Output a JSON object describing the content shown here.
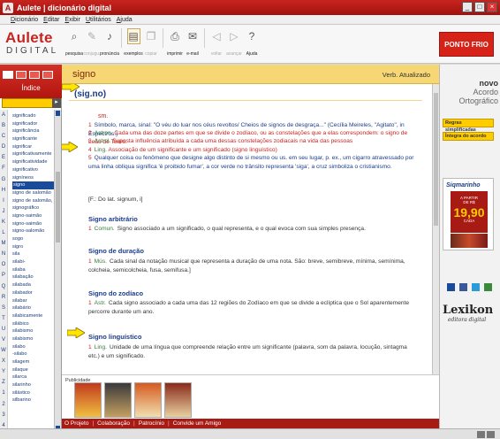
{
  "window": {
    "title": "Aulete | dicionário digital",
    "app_icon": "A"
  },
  "menu": [
    "Dicionário",
    "Editar",
    "Exibir",
    "Utilitários",
    "Ajuda"
  ],
  "logo": {
    "line1": "Aulete",
    "line2": "DIGITAL"
  },
  "toolbar": [
    {
      "label": "pesquisa",
      "icon": "magnifier-icon",
      "glyph": "⌕",
      "state": "on"
    },
    {
      "label": "conjugu.",
      "icon": "conjugation-icon",
      "glyph": "✎",
      "state": "off"
    },
    {
      "label": "pronúncia",
      "icon": "speaker-icon",
      "glyph": "♪",
      "state": "on"
    },
    {
      "label": "exemplos",
      "icon": "examples-icon",
      "glyph": "▤",
      "state": "boxed"
    },
    {
      "label": "copiar",
      "icon": "copy-icon",
      "glyph": "❐",
      "state": "off"
    },
    {
      "label": "imprimir",
      "icon": "print-icon",
      "glyph": "⎙",
      "state": "on"
    },
    {
      "label": "e-mail",
      "icon": "email-icon",
      "glyph": "✉",
      "state": "on"
    },
    {
      "label": "voltar",
      "icon": "back-icon",
      "glyph": "◁",
      "state": "off"
    },
    {
      "label": "avançar",
      "icon": "forward-icon",
      "glyph": "▷",
      "state": "off"
    },
    {
      "label": "Ajuda",
      "icon": "help-icon",
      "glyph": "?",
      "state": "on"
    }
  ],
  "ads": {
    "pontofrio": "PONTO FRIO"
  },
  "index": {
    "title": "Índice",
    "alphabet": [
      "A",
      "B",
      "C",
      "D",
      "E",
      "F",
      "G",
      "H",
      "I",
      "J",
      "K",
      "L",
      "M",
      "N",
      "O",
      "P",
      "Q",
      "R",
      "S",
      "T",
      "U",
      "V",
      "W",
      "X",
      "Y",
      "Z",
      "1",
      "2",
      "3",
      "4"
    ],
    "words": [
      "significado",
      "significador",
      "significância",
      "significante",
      "significar",
      "significativamente",
      "significatividade",
      "significativo",
      "signíneos",
      "signo",
      "signo de salomão",
      "signo de salomão, sig",
      "signográfico",
      "signo-saimão",
      "signo-saimão",
      "signo-salomão",
      "sogo",
      "sigro",
      "sila",
      "silabi-",
      "silaba",
      "silabação",
      "silabada",
      "silabador",
      "silabar",
      "silabário",
      "silabicamente",
      "silábico",
      "silabismo",
      "silabismo",
      "silabo",
      "-silabo",
      "silagem",
      "silaque",
      "silarca",
      "silarinho",
      "silástico",
      "silbarino"
    ],
    "selected_index": 9
  },
  "entry": {
    "word": "signo",
    "header_right": "Verb. Atualizado",
    "headword": "(sig.no)",
    "pos": "sm.",
    "definitions": [
      {
        "n": "1",
        "domain": "",
        "text": "Símbolo, marca, sinal: \"O véu do luar nos céus revoltos/ Cheios de signos de desgraça...\" (Cecília Meireles, \"Agitato\", in Espectros.)"
      },
      {
        "n": "2",
        "domain": "Astron.",
        "text": "Cada uma das doze partes em que se divide o zodíaco, ou as constelações que a elas correspondem: o signo de Leão de Touro."
      },
      {
        "n": "3",
        "domain": "Astrol.",
        "text": "Suposta influência atribuída a cada uma dessas constelações zodiacais na vida das pessoas"
      },
      {
        "n": "4",
        "domain": "Ling.",
        "text": "Associação de um significante e um significado (signo linguístico)"
      },
      {
        "n": "5",
        "domain": "",
        "text": "Qualquer coisa ou fenômeno que designe algo distinto de si mesmo ou us. em seu lugar, p. ex., um cigarro atravessado por uma linha oblíqua significa 'é proibido fumar', a cor verde no trânsito representa 'siga', a cruz simboliza o cristianismo."
      }
    ],
    "etymology": "[F.: Do lat. signum, i]",
    "subentries": [
      {
        "title": "Signo arbitrário",
        "n": "1",
        "domain": "Comun.",
        "text": "Signo associado a um significado, o qual representa, e o qual evoca com sua simples presença."
      },
      {
        "title": "Signo de duração",
        "n": "1",
        "domain": "Mús.",
        "text": "Cada sinal da notação musical que representa a duração de uma nota. São: breve, semibreve, mínima, semínima, colcheia, semicolcheia, fusa, semifusa.]"
      },
      {
        "title": "Signo do zodíaco",
        "n": "1",
        "domain": "Astr.",
        "text": "Cada signo associado a cada uma das 12 regiões do Zodíaco em que se divide a eclíptica que o Sol aparentemente percorre durante um ano."
      },
      {
        "title": "Signo linguístico",
        "n": "1",
        "domain": "Ling.",
        "text": "Unidade de uma língua que compreende relação entre um significante (palavra, som da palavra, locução, sintagma etc.) e um significado."
      }
    ]
  },
  "publicidade": {
    "label": "Publicidade"
  },
  "footer": [
    "O Projeto",
    "Colaboração",
    "Patrocínio",
    "Convide um Amigo"
  ],
  "right": {
    "novo": "novo",
    "acordo": "Acordo",
    "ortografico": "Ortográfico",
    "btn1": "Regras simplificadas",
    "btn2": "Íntegra do acordo",
    "sig": {
      "brand": "Siqmarinho",
      "line1": "A PARTIR",
      "line2": "DE R$",
      "price": "19,90",
      "line3": "CADA"
    },
    "lexikon": "Lexikon",
    "lexikon_sub": "editora digital"
  },
  "colors": {
    "brand_red": "#c8241f",
    "gold": "#f6d774",
    "link_blue": "#1a3c8a"
  }
}
